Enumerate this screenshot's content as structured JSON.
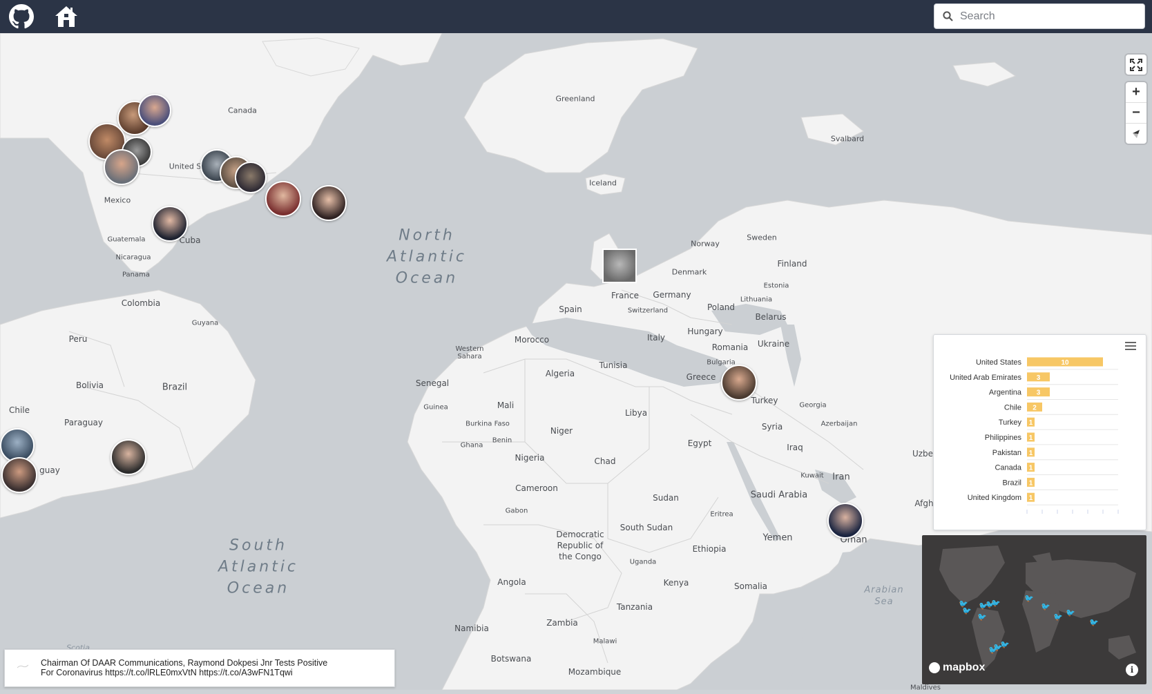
{
  "header": {
    "github_icon": "github-icon",
    "home_icon": "home-icon",
    "search": {
      "placeholder": "Search",
      "value": ""
    }
  },
  "map": {
    "oceans": [
      {
        "name": "North\nAtlantic\nOcean"
      },
      {
        "name": "South\nAtlantic\nOcean"
      },
      {
        "name": "Arabian\nSea"
      }
    ],
    "labels": {
      "greenland": "Greenland",
      "canada": "Canada",
      "united_states": "United S",
      "mexico": "Mexico",
      "guatemala": "Guatemala",
      "cuba": "Cuba",
      "nicaragua": "Nicaragua",
      "panama": "Panama",
      "colombia": "Colombia",
      "guyana": "Guyana",
      "peru": "Peru",
      "bolivia": "Bolivia",
      "brazil": "Brazil",
      "chile": "Chile",
      "paraguay": "Paraguay",
      "uruguay": "guay",
      "iceland": "Iceland",
      "svalbard": "Svalbard",
      "norway": "Norway",
      "sweden": "Sweden",
      "finland": "Finland",
      "denmark": "Denmark",
      "estonia": "Estonia",
      "lithuania": "Lithuania",
      "belarus": "Belarus",
      "poland": "Poland",
      "germany": "Germany",
      "france": "France",
      "switzerland": "Switzerland",
      "spain": "Spain",
      "italy": "Italy",
      "hungary": "Hungary",
      "romania": "Romania",
      "ukraine": "Ukraine",
      "bulgaria": "Bulgaria",
      "greece": "Greece",
      "turkey": "Turkey",
      "georgia": "Georgia",
      "azerbaijan": "Azerbaijan",
      "syria": "Syria",
      "iraq": "Iraq",
      "iran": "Iran",
      "kuwait": "Kuwait",
      "saudi_arabia": "Saudi Arabia",
      "yemen": "Yemen",
      "oman": "Oman",
      "uzbek": "Uzbe",
      "afgh": "Afgh",
      "egypt": "Egypt",
      "libya": "Libya",
      "tunisia": "Tunisia",
      "algeria": "Algeria",
      "morocco": "Morocco",
      "western_sahara": "Western\nSahara",
      "mali": "Mali",
      "niger": "Niger",
      "chad": "Chad",
      "sudan": "Sudan",
      "south_sudan": "South Sudan",
      "eritrea": "Eritrea",
      "ethiopia": "Ethiopia",
      "somalia": "Somalia",
      "kenya": "Kenya",
      "uganda": "Uganda",
      "tanzania": "Tanzania",
      "drc": "Democratic\nRepublic of\nthe Congo",
      "senegal": "Senegal",
      "guinea": "Guinea",
      "burkina_faso": "Burkina Faso",
      "benin": "Benin",
      "ghana": "Ghana",
      "nigeria": "Nigeria",
      "cameroon": "Cameroon",
      "gabon": "Gabon",
      "angola": "Angola",
      "zambia": "Zambia",
      "malawi": "Malawi",
      "namibia": "Namibia",
      "botswana": "Botswana",
      "mozambique": "Mozambique",
      "scotia": "Scotia",
      "maldives": "Maldives"
    }
  },
  "controls": {
    "fullscreen_icon": "fullscreen-icon",
    "zoom_in": "+",
    "zoom_out": "−",
    "compass_icon": "compass-icon"
  },
  "chart_data": {
    "type": "bar",
    "orientation": "horizontal",
    "categories": [
      "United States",
      "United Arab Emirates",
      "Argentina",
      "Chile",
      "Turkey",
      "Philippines",
      "Pakistan",
      "Canada",
      "Brazil",
      "United Kingdom"
    ],
    "values": [
      10,
      3,
      3,
      2,
      1,
      1,
      1,
      1,
      1,
      1
    ],
    "xlim": [
      0,
      12
    ],
    "bar_color": "#f7c765",
    "title": "",
    "xlabel": "",
    "ylabel": "",
    "data_labels": true
  },
  "chart_menu_icon": "hamburger-icon",
  "minimap": {
    "logo_text": "mapbox",
    "info_icon": "info-icon",
    "marker_icon": "twitter-bird-icon"
  },
  "tweet": {
    "line1": "Chairman Of DAAR Communications, Raymond Dokpesi Jnr Tests Positive",
    "line2": "For Coronavirus https://t.co/lRLE0mxVtN https://t.co/A3wFN1Tqwi"
  },
  "colors": {
    "header_bg": "#2b3446",
    "land": "#f4f4f4",
    "water": "#cbcfd3",
    "bar": "#f7c765"
  }
}
